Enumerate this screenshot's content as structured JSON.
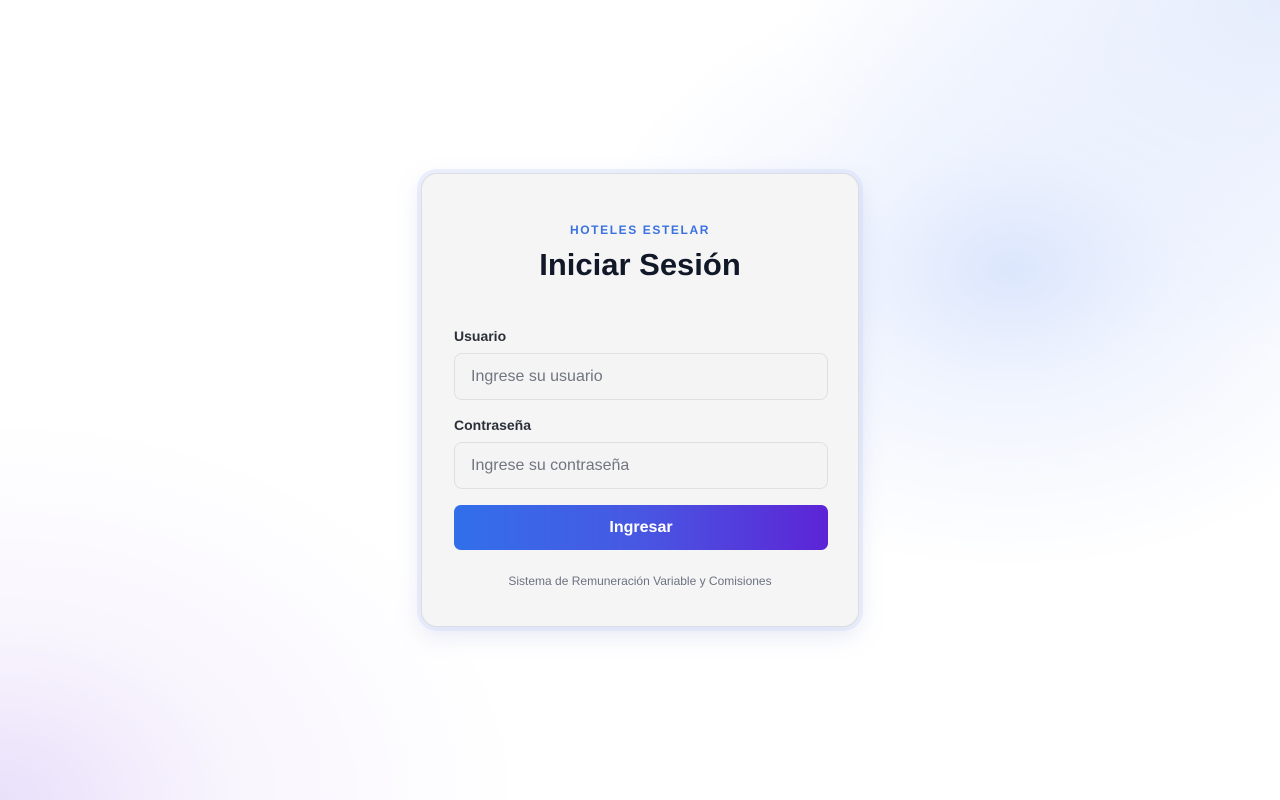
{
  "login": {
    "brand": "HOTELES ESTELAR",
    "title": "Iniciar Sesión",
    "username": {
      "label": "Usuario",
      "value": "",
      "placeholder": "Ingrese su usuario"
    },
    "password": {
      "label": "Contraseña",
      "value": "",
      "placeholder": "Ingrese su contraseña"
    },
    "submit_label": "Ingresar",
    "footer": "Sistema de Remuneración Variable y Comisiones"
  },
  "colors": {
    "brand_accent": "#3a72e0",
    "button_gradient_start": "#326fea",
    "button_gradient_end": "#5d24d6",
    "title": "#111827",
    "card_background": "#f5f5f6"
  }
}
